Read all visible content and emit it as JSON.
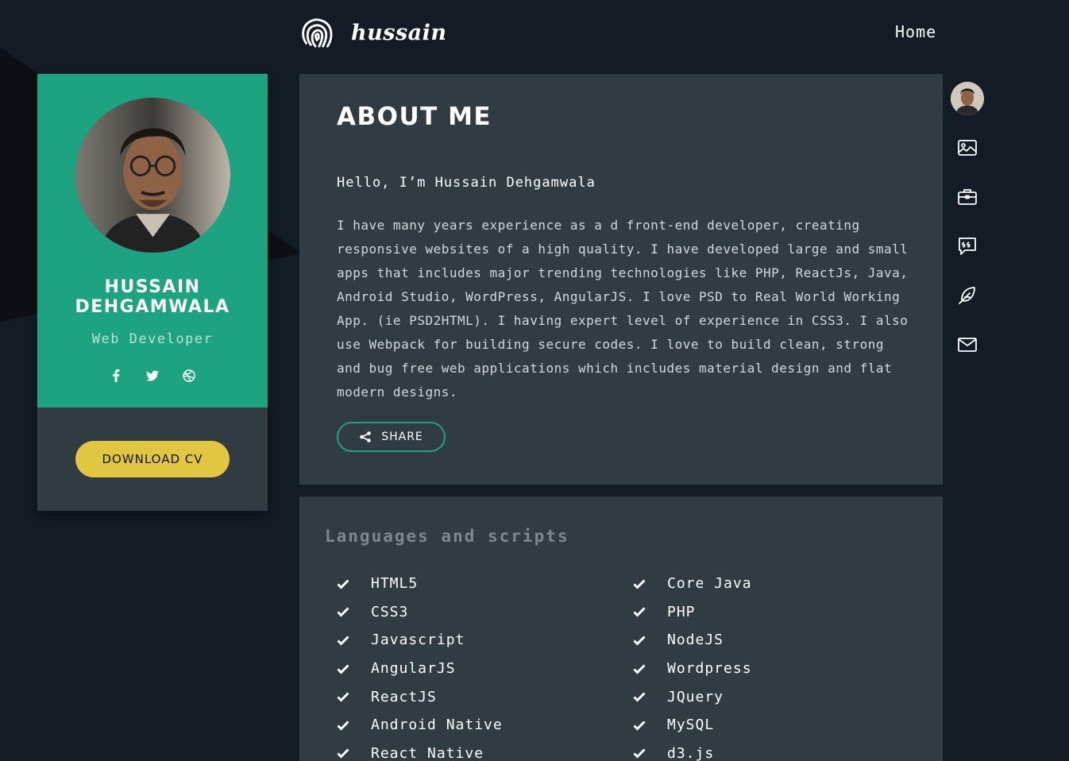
{
  "header": {
    "logo_text": "hussain",
    "nav_home": "Home"
  },
  "profile": {
    "name": "HUSSAIN DEHGAMWALA",
    "role": "Web Developer",
    "socials": [
      "facebook-icon",
      "twitter-icon",
      "dribbble-icon"
    ],
    "download_label": "DOWNLOAD CV"
  },
  "about": {
    "title": "ABOUT ME",
    "hello": "Hello, I’m Hussain Dehgamwala",
    "body": "I have many years experience as a d front-end developer, creating responsive websites of a high quality. I have developed large and small apps that includes major trending technologies like PHP, ReactJs, Java, Android Studio, WordPress, AngularJS. I love PSD to Real World Working App. (ie PSD2HTML). I having expert level of experience in CSS3. I also use Webpack for building secure codes. I love to build clean, strong and bug free web applications which includes material design and flat modern designs.",
    "share_label": "SHARE"
  },
  "side_nav": [
    "profile-avatar",
    "portfolio-icon",
    "briefcase-icon",
    "quote-icon",
    "feather-icon",
    "mail-icon"
  ],
  "skills": {
    "title": "Languages and scripts",
    "col1": [
      "HTML5",
      "CSS3",
      "Javascript",
      "AngularJS",
      "ReactJS",
      "Android Native",
      "React Native"
    ],
    "col2": [
      "Core Java",
      "PHP",
      "NodeJS",
      "Wordpress",
      "JQuery",
      "MySQL",
      "d3.js"
    ]
  },
  "colors": {
    "background": "#131c24",
    "panel": "#313b42",
    "accent_green": "#1ea381",
    "accent_yellow": "#e0c641"
  }
}
